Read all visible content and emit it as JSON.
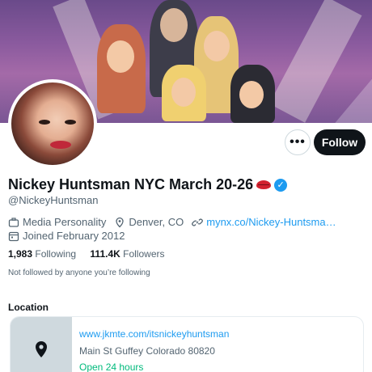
{
  "profile": {
    "display_name": "Nickey Huntsman NYC March 20-26",
    "name_emoji": "lips-emoji",
    "verified": true,
    "handle": "@NickeyHuntsman",
    "category": "Media Personality",
    "location": "Denver, CO",
    "website": "mynx.co/Nickey-Huntsma…",
    "joined": "Joined February 2012",
    "following_count": "1,983",
    "following_label": "Following",
    "followers_count": "111.4K",
    "followers_label": "Followers",
    "followed_by": "Not followed by anyone you’re following"
  },
  "actions": {
    "more_label": "•••",
    "follow_label": "Follow"
  },
  "location_card": {
    "section_title": "Location",
    "url": "www.jkmte.com/itsnickeyhuntsman",
    "address": "Main St Guffey Colorado 80820",
    "hours": "Open 24 hours"
  },
  "colors": {
    "accent": "#1d9bf0",
    "text_primary": "#0f1419",
    "text_secondary": "#536471",
    "open_green": "#00ba7c",
    "follow_bg": "#0f1419"
  }
}
